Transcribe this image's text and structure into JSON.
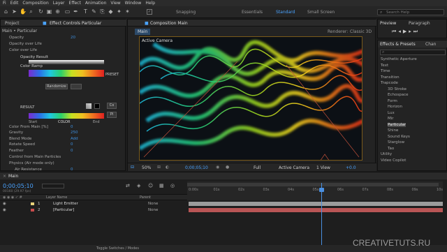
{
  "menu": [
    "Fi",
    "Edit",
    "Composition",
    "Layer",
    "Effect",
    "Animation",
    "View",
    "Window",
    "Help"
  ],
  "workspaces": {
    "snapping": "Snapping",
    "essentials": "Essentials",
    "standard": "Standard",
    "small_screen": "Small Screen",
    "search_placeholder": "Search Help"
  },
  "project": {
    "tab": "Project",
    "effect_tab": "Effect Controls Particular",
    "subtitle": "Main • Particular"
  },
  "effect_controls": [
    {
      "label": "Opacity",
      "value": "20",
      "indent": 1
    },
    {
      "label": "Opacity over Life",
      "value": "",
      "indent": 1
    },
    {
      "label": "Color over Life",
      "value": "",
      "indent": 1
    },
    {
      "label": "Opacity Result",
      "value": "",
      "indent": 3
    },
    {
      "label": "Color Ramp",
      "value": "",
      "indent": 3
    },
    {
      "label": "RESULT",
      "value": "",
      "indent": 3
    },
    {
      "label": "Color From Main [%]",
      "value": "0",
      "indent": 1
    },
    {
      "label": "Gravity",
      "value": "250",
      "indent": 1
    },
    {
      "label": "Blend Mode",
      "value": "Add",
      "indent": 1
    },
    {
      "label": "Rotate Speed",
      "value": "0",
      "indent": 1
    },
    {
      "label": "Feather",
      "value": "0",
      "indent": 1
    },
    {
      "label": "Control from Main Particles",
      "value": "",
      "indent": 1
    },
    {
      "label": "Physics (Air mode only)",
      "value": "",
      "indent": 1
    },
    {
      "label": "Air Resistance",
      "value": "0",
      "indent": 2
    }
  ],
  "ramp": {
    "preset": "PRESET",
    "randomize": "Randomize",
    "result": "RESULT",
    "start": "Start",
    "color": "COLOR",
    "end": "End",
    "co": "Co",
    "pi": "Pi"
  },
  "composition": {
    "tab": "Composition Main",
    "main_tab": "Main",
    "renderer_label": "Renderer:",
    "renderer": "Classic 3D",
    "camera_label": "Active Camera"
  },
  "viewer_bar": {
    "zoom": "50%",
    "time": "0;00;05;10",
    "resolution": "Full",
    "camera": "Active Camera",
    "views": "1 View",
    "offset": "+0.0"
  },
  "preview": {
    "tab": "Preview",
    "paragraph_tab": "Paragraph"
  },
  "effects_presets": {
    "tab": "Effects & Presets",
    "chan_tab": "Chan",
    "items": [
      "Synthetic Aperture",
      "Text",
      "Time",
      "Transition",
      "Trapcode",
      "3D Stroke",
      "Echospace",
      "Form",
      "Horizon",
      "Lux",
      "Mir",
      "Particular",
      "Shine",
      "Sound Keys",
      "Starglow",
      "Tao",
      "Utility",
      "Video Copilot"
    ],
    "selected": "Particular"
  },
  "timeline": {
    "tab": "Main",
    "timecode": "0;00;05;10",
    "frame": "00160 (29.97 fps)",
    "col_layer": "Layer Name",
    "col_parent": "Parent",
    "layers": [
      {
        "num": "1",
        "name": "Light Emitter",
        "parent": "None",
        "color": "#e8d27a"
      },
      {
        "num": "2",
        "name": "[Particular]",
        "parent": "None",
        "color": "#c94c4c"
      }
    ],
    "ticks": [
      "0:00s",
      "01s",
      "02s",
      "03s",
      "04s",
      "05s",
      "06s",
      "07s",
      "08s",
      "09s",
      "10s"
    ],
    "footer": "Toggle Switches / Modes"
  },
  "watermark": "CREATIVETUTS.RU"
}
